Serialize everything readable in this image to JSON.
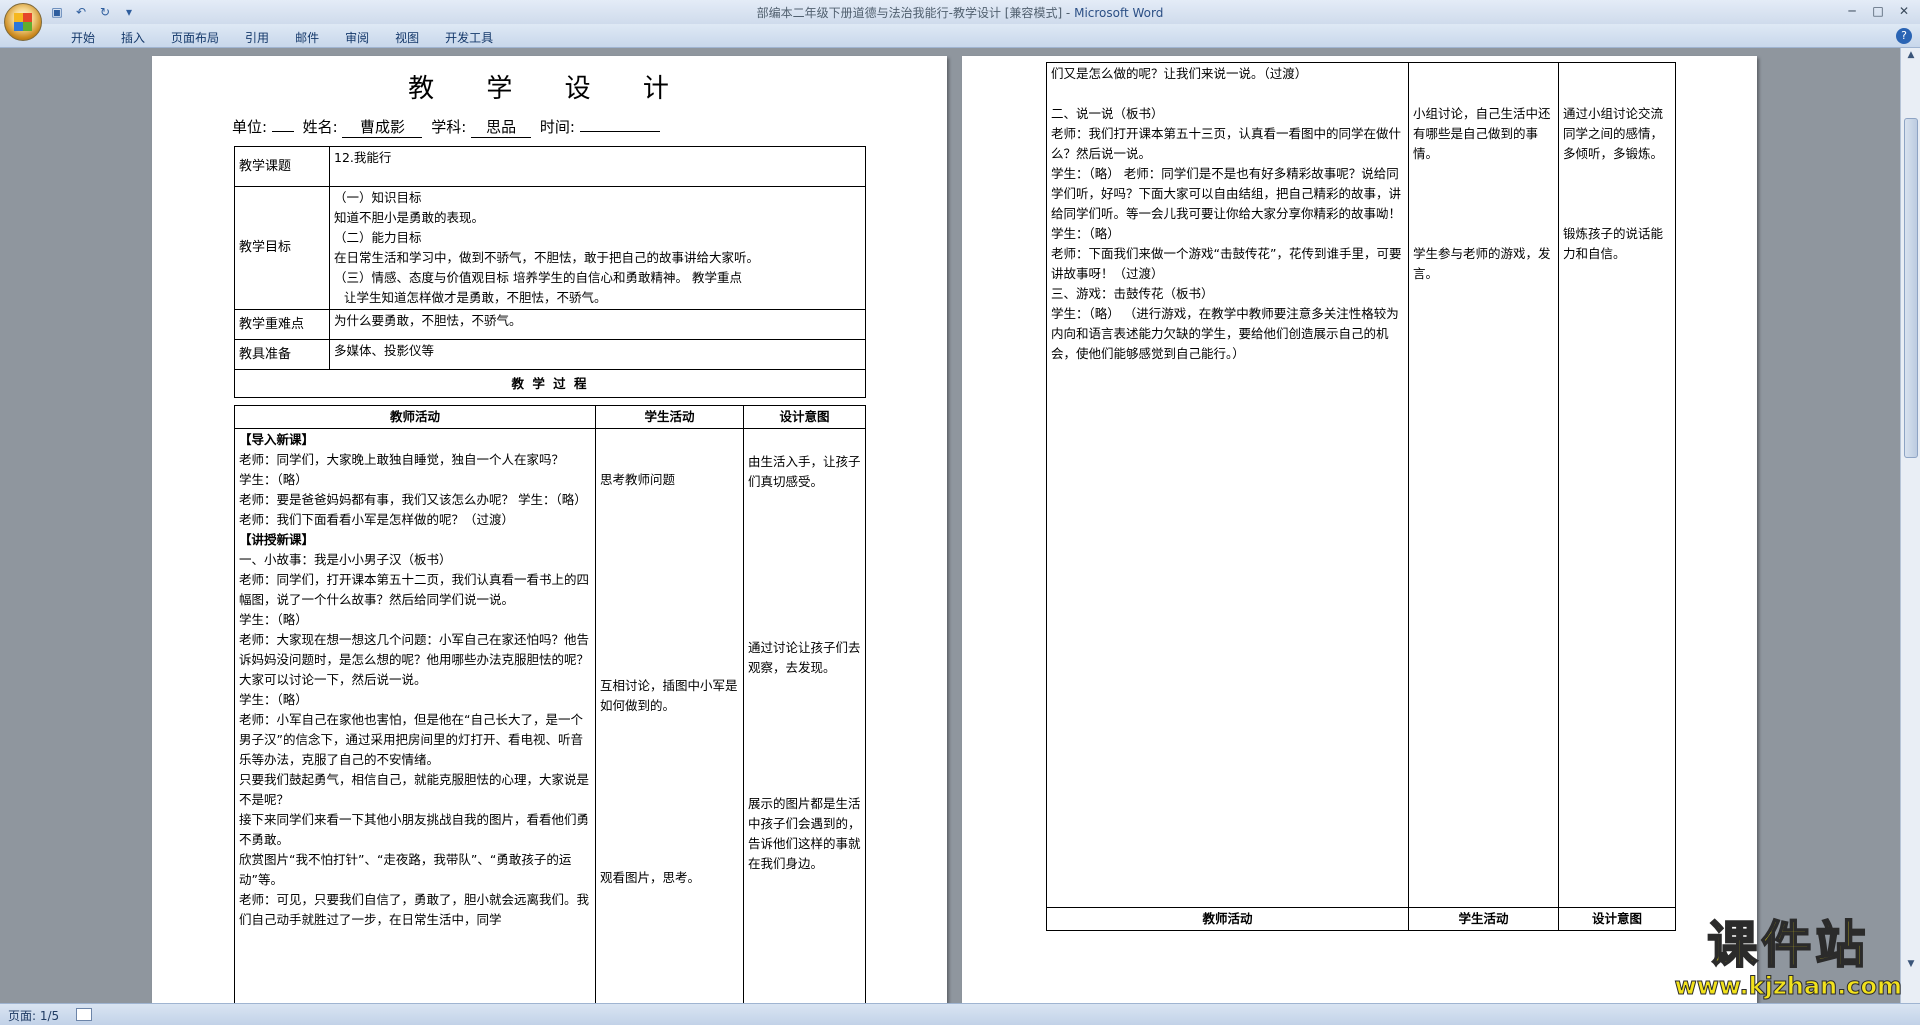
{
  "window": {
    "title": "部编本二年级下册道德与法治我能行-教学设计 [兼容模式] - ",
    "app_name": "Microsoft Word"
  },
  "ribbon": {
    "tabs": [
      "开始",
      "插入",
      "页面布局",
      "引用",
      "邮件",
      "审阅",
      "视图",
      "开发工具"
    ]
  },
  "icons": {
    "office": "office-logo-icon",
    "save": "save-icon",
    "undo": "undo-icon",
    "redo": "redo-icon",
    "help": "help-icon"
  },
  "page1": {
    "title": "教 学 设 计",
    "info": {
      "unit_label": "单位:",
      "unit_value": "",
      "name_label": "姓名:",
      "name_value": "曹成影",
      "subject_label": "学科:",
      "subject_value": "思品",
      "time_label": "时间:",
      "time_value": ""
    },
    "info_table": {
      "topic_label": "教学课题",
      "topic_value": "12.我能行",
      "goals_label": "教学目标",
      "goals": [
        "（一）知识目标",
        "知道不胆小是勇敢的表现。",
        "（二）能力目标",
        "在日常生活和学习中，做到不骄气，不胆怯，敢于把自己的故事讲给大家听。",
        "（三）情感、态度与价值观目标  培养学生的自信心和勇敢精神。  教学重点",
        "让学生知道怎样做才是勇敢，不胆怯，不骄气。"
      ],
      "difficulty_label": "教学重难点",
      "difficulty_value": "为什么要勇敢，不胆怯，不骄气。",
      "tools_label": "教具准备",
      "tools_value": "多媒体、投影仪等",
      "process_title": "教 学 过 程"
    },
    "process_headers": [
      "教师活动",
      "学生活动",
      "设计意图"
    ],
    "teacher_lines": [
      "【导入新课】",
      "老师：同学们，大家晚上敢独自睡觉，独自一个人在家吗？",
      "学生：（略）",
      "老师：要是爸爸妈妈都有事，我们又该怎么办呢？  学生：（略）",
      "老师：我们下面看看小军是怎样做的呢？（过渡）",
      "【讲授新课】",
      "一、小故事：我是小小男子汉（板书）",
      "老师：同学们，打开课本第五十二页，我们认真看一看书上的四幅图，说了一个什么故事？然后给同学们说一说。",
      "学生：（略）",
      "老师：大家现在想一想这几个问题：小军自己在家还怕吗？他告诉妈妈没问题时，是怎么想的呢？他用哪些办法克服胆怯的呢？大家可以讨论一下，然后说一说。",
      "学生：（略）",
      "老师：小军自己在家他也害怕，但是他在“自己长大了，是一个男子汉”的信念下，通过采用把房间里的灯打开、看电视、听音乐等办法，克服了自己的不安情绪。",
      "只要我们鼓起勇气，相信自己，就能克服胆怯的心理，大家说是不是呢？",
      "接下来同学们来看一下其他小朋友挑战自我的图片，看看他们勇不勇敢。",
      "欣赏图片“我不怕打针”、“走夜路，我带队”、“勇敢孩子的运动”等。",
      "老师：可见，只要我们自信了，勇敢了，胆小就会远离我们。我们自己动手就胜过了一步，在日常生活中，同学"
    ],
    "student_notes": {
      "n1": "思考教师问题",
      "n2": "互相讨论，插图中小军是如何做到的。",
      "n3": "观看图片，思考。"
    },
    "design_notes": {
      "d1": "由生活入手，让孩子们真切感受。",
      "d2": "通过讨论让孩子们去观察，去发现。",
      "d3": "展示的图片都是生活中孩子们会遇到的，告诉他们这样的事就在我们身边。"
    }
  },
  "page2": {
    "teacher_lines": [
      "们又是怎么做的呢？让我们来说一说。（过渡）",
      "",
      "二、说一说（板书）",
      "老师：我们打开课本第五十三页，认真看一看图中的同学在做什么？然后说一说。",
      "学生：（略）  老师：同学们是不是也有好多精彩故事呢？说给同学们听，好吗？下面大家可以自由结组，把自己精彩的故事，讲给同学们听。等一会儿我可要让你给大家分享你精彩的故事呦！",
      "学生：（略）",
      "老师：下面我们来做一个游戏“击鼓传花”，花传到谁手里，可要讲故事呀！（过渡）",
      "三、游戏：击鼓传花（板书）",
      "学生：（略）  （进行游戏，在教学中教师要注意多关注性格较为内向和语言表述能力欠缺的学生，要给他们创造展示自己的机会，使他们能够感觉到自己能行。）"
    ],
    "student_notes": {
      "n1": "小组讨论，自己生活中还有哪些是自己做到的事情。",
      "n2": "学生参与老师的游戏，发言。"
    },
    "design_notes": {
      "d1": "通过小组讨论交流同学之间的感情，多倾听，多锻炼。",
      "d2": "锻炼孩子的说话能力和自信。"
    },
    "footer_headers": [
      "教师活动",
      "学生活动",
      "设计意图"
    ]
  },
  "status": {
    "page": "页面: 1/5"
  },
  "watermark": {
    "brand": "课件站",
    "url": "www.kjzhan.com"
  }
}
